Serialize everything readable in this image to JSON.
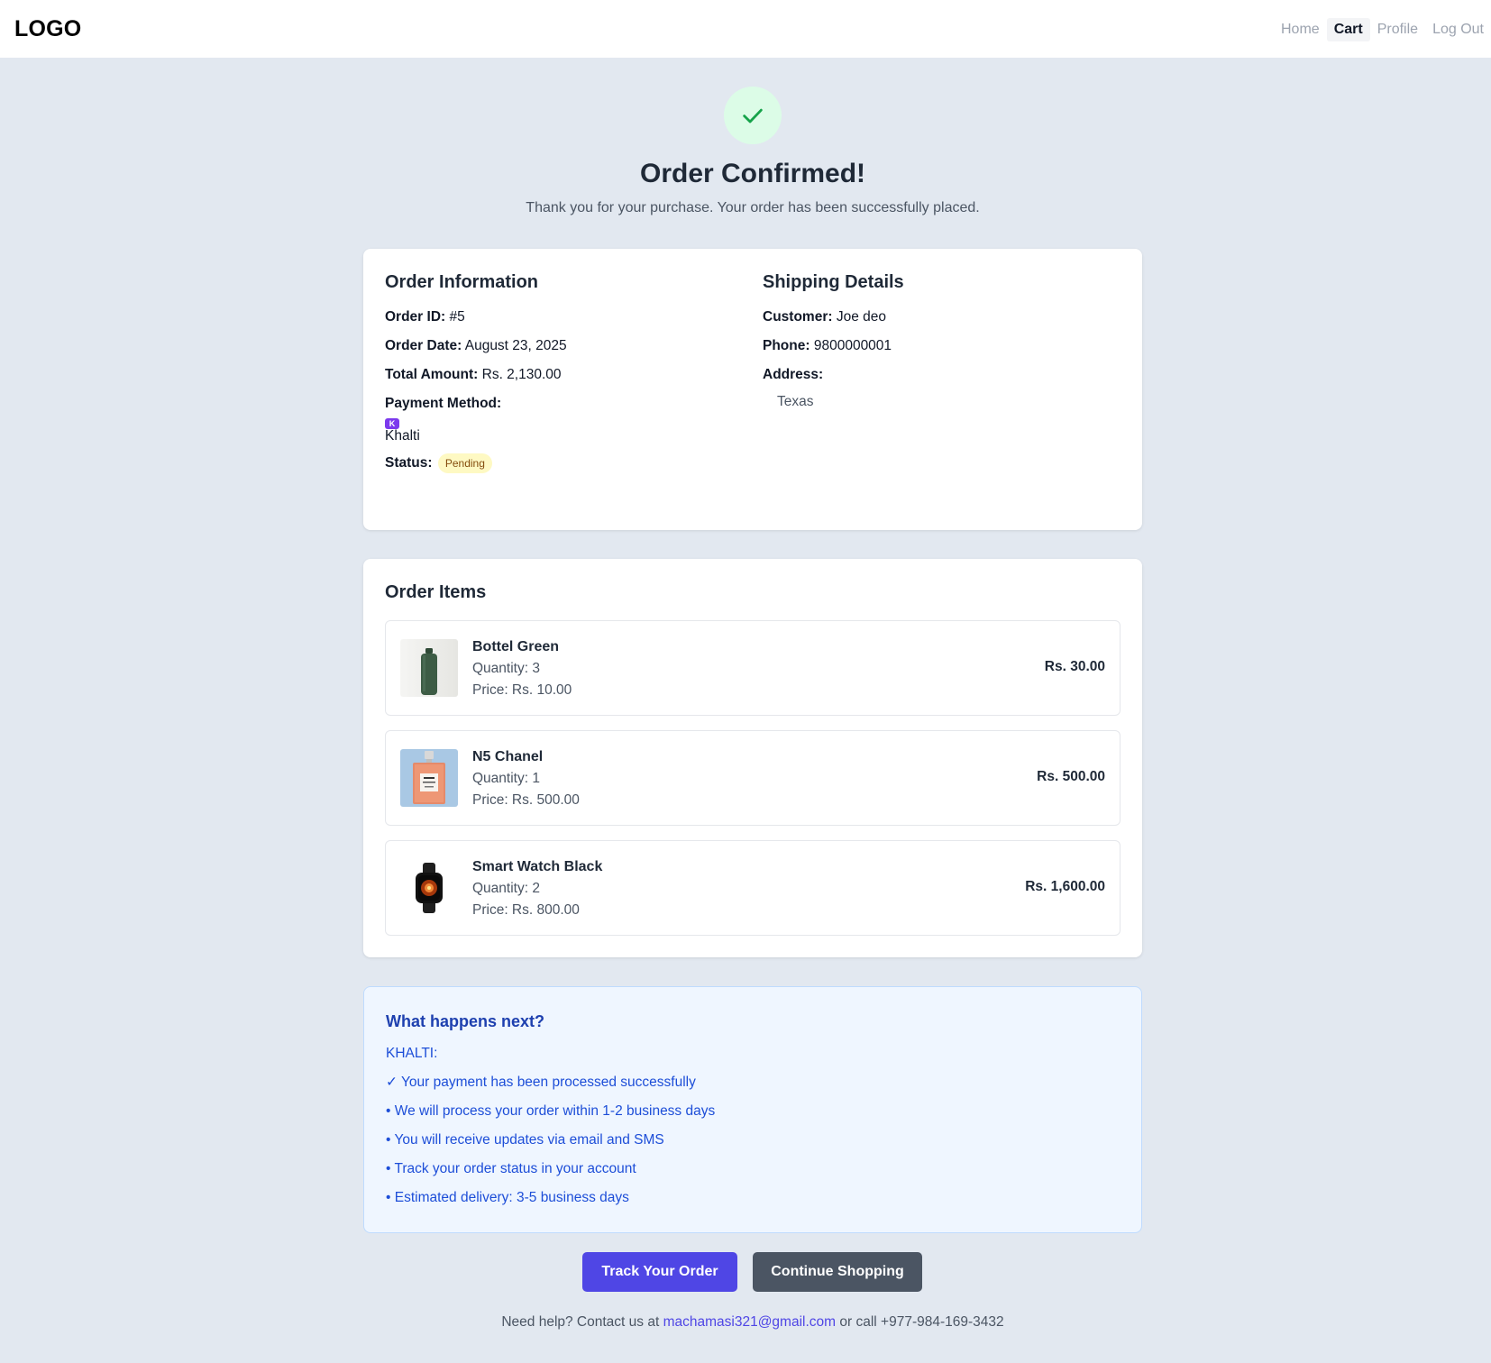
{
  "header": {
    "logo": "LOGO",
    "nav": [
      "Home",
      "Cart",
      "Profile",
      "Log Out"
    ],
    "active_nav": "Cart"
  },
  "hero": {
    "icon": "check-icon",
    "title": "Order Confirmed!",
    "subtitle": "Thank you for your purchase. Your order has been successfully placed."
  },
  "order_info": {
    "title": "Order Information",
    "order_id_label": "Order ID:",
    "order_id": "#5",
    "order_date_label": "Order Date:",
    "order_date": "August 23, 2025",
    "total_label": "Total Amount:",
    "total": "Rs. 2,130.00",
    "payment_label": "Payment Method:",
    "payment_icon": "K",
    "payment_method": "Khalti",
    "status_label": "Status:",
    "status": "Pending"
  },
  "shipping": {
    "title": "Shipping Details",
    "customer_label": "Customer:",
    "customer": "Joe deo",
    "phone_label": "Phone:",
    "phone": "9800000001",
    "address_label": "Address:",
    "address": "Texas"
  },
  "items": {
    "title": "Order Items",
    "list": [
      {
        "name": "Bottel Green",
        "quantity": "Quantity: 3",
        "price": "Price: Rs. 10.00",
        "total": "Rs. 30.00",
        "image": "green-bottle"
      },
      {
        "name": "N5 Chanel",
        "quantity": "Quantity: 1",
        "price": "Price: Rs. 500.00",
        "total": "Rs. 500.00",
        "image": "perfume-bottle"
      },
      {
        "name": "Smart Watch Black",
        "quantity": "Quantity: 2",
        "price": "Price: Rs. 800.00",
        "total": "Rs. 1,600.00",
        "image": "smart-watch"
      }
    ]
  },
  "next_steps": {
    "title": "What happens next?",
    "lines": [
      "KHALTI:",
      "✓ Your payment has been processed successfully",
      "• We will process your order within 1-2 business days",
      "• You will receive updates via email and SMS",
      "• Track your order status in your account",
      "• Estimated delivery: 3-5 business days"
    ]
  },
  "actions": {
    "track": "Track Your Order",
    "continue": "Continue Shopping"
  },
  "help": {
    "prefix": "Need help? Contact us at",
    "email": "machamasi321@gmail.com",
    "suffix": "or call +977-984-169-3432"
  },
  "colors": {
    "accent": "#4f46e5",
    "success": "#16a34a",
    "pending_bg": "#fef9c3",
    "khalti": "#7c3aed"
  }
}
